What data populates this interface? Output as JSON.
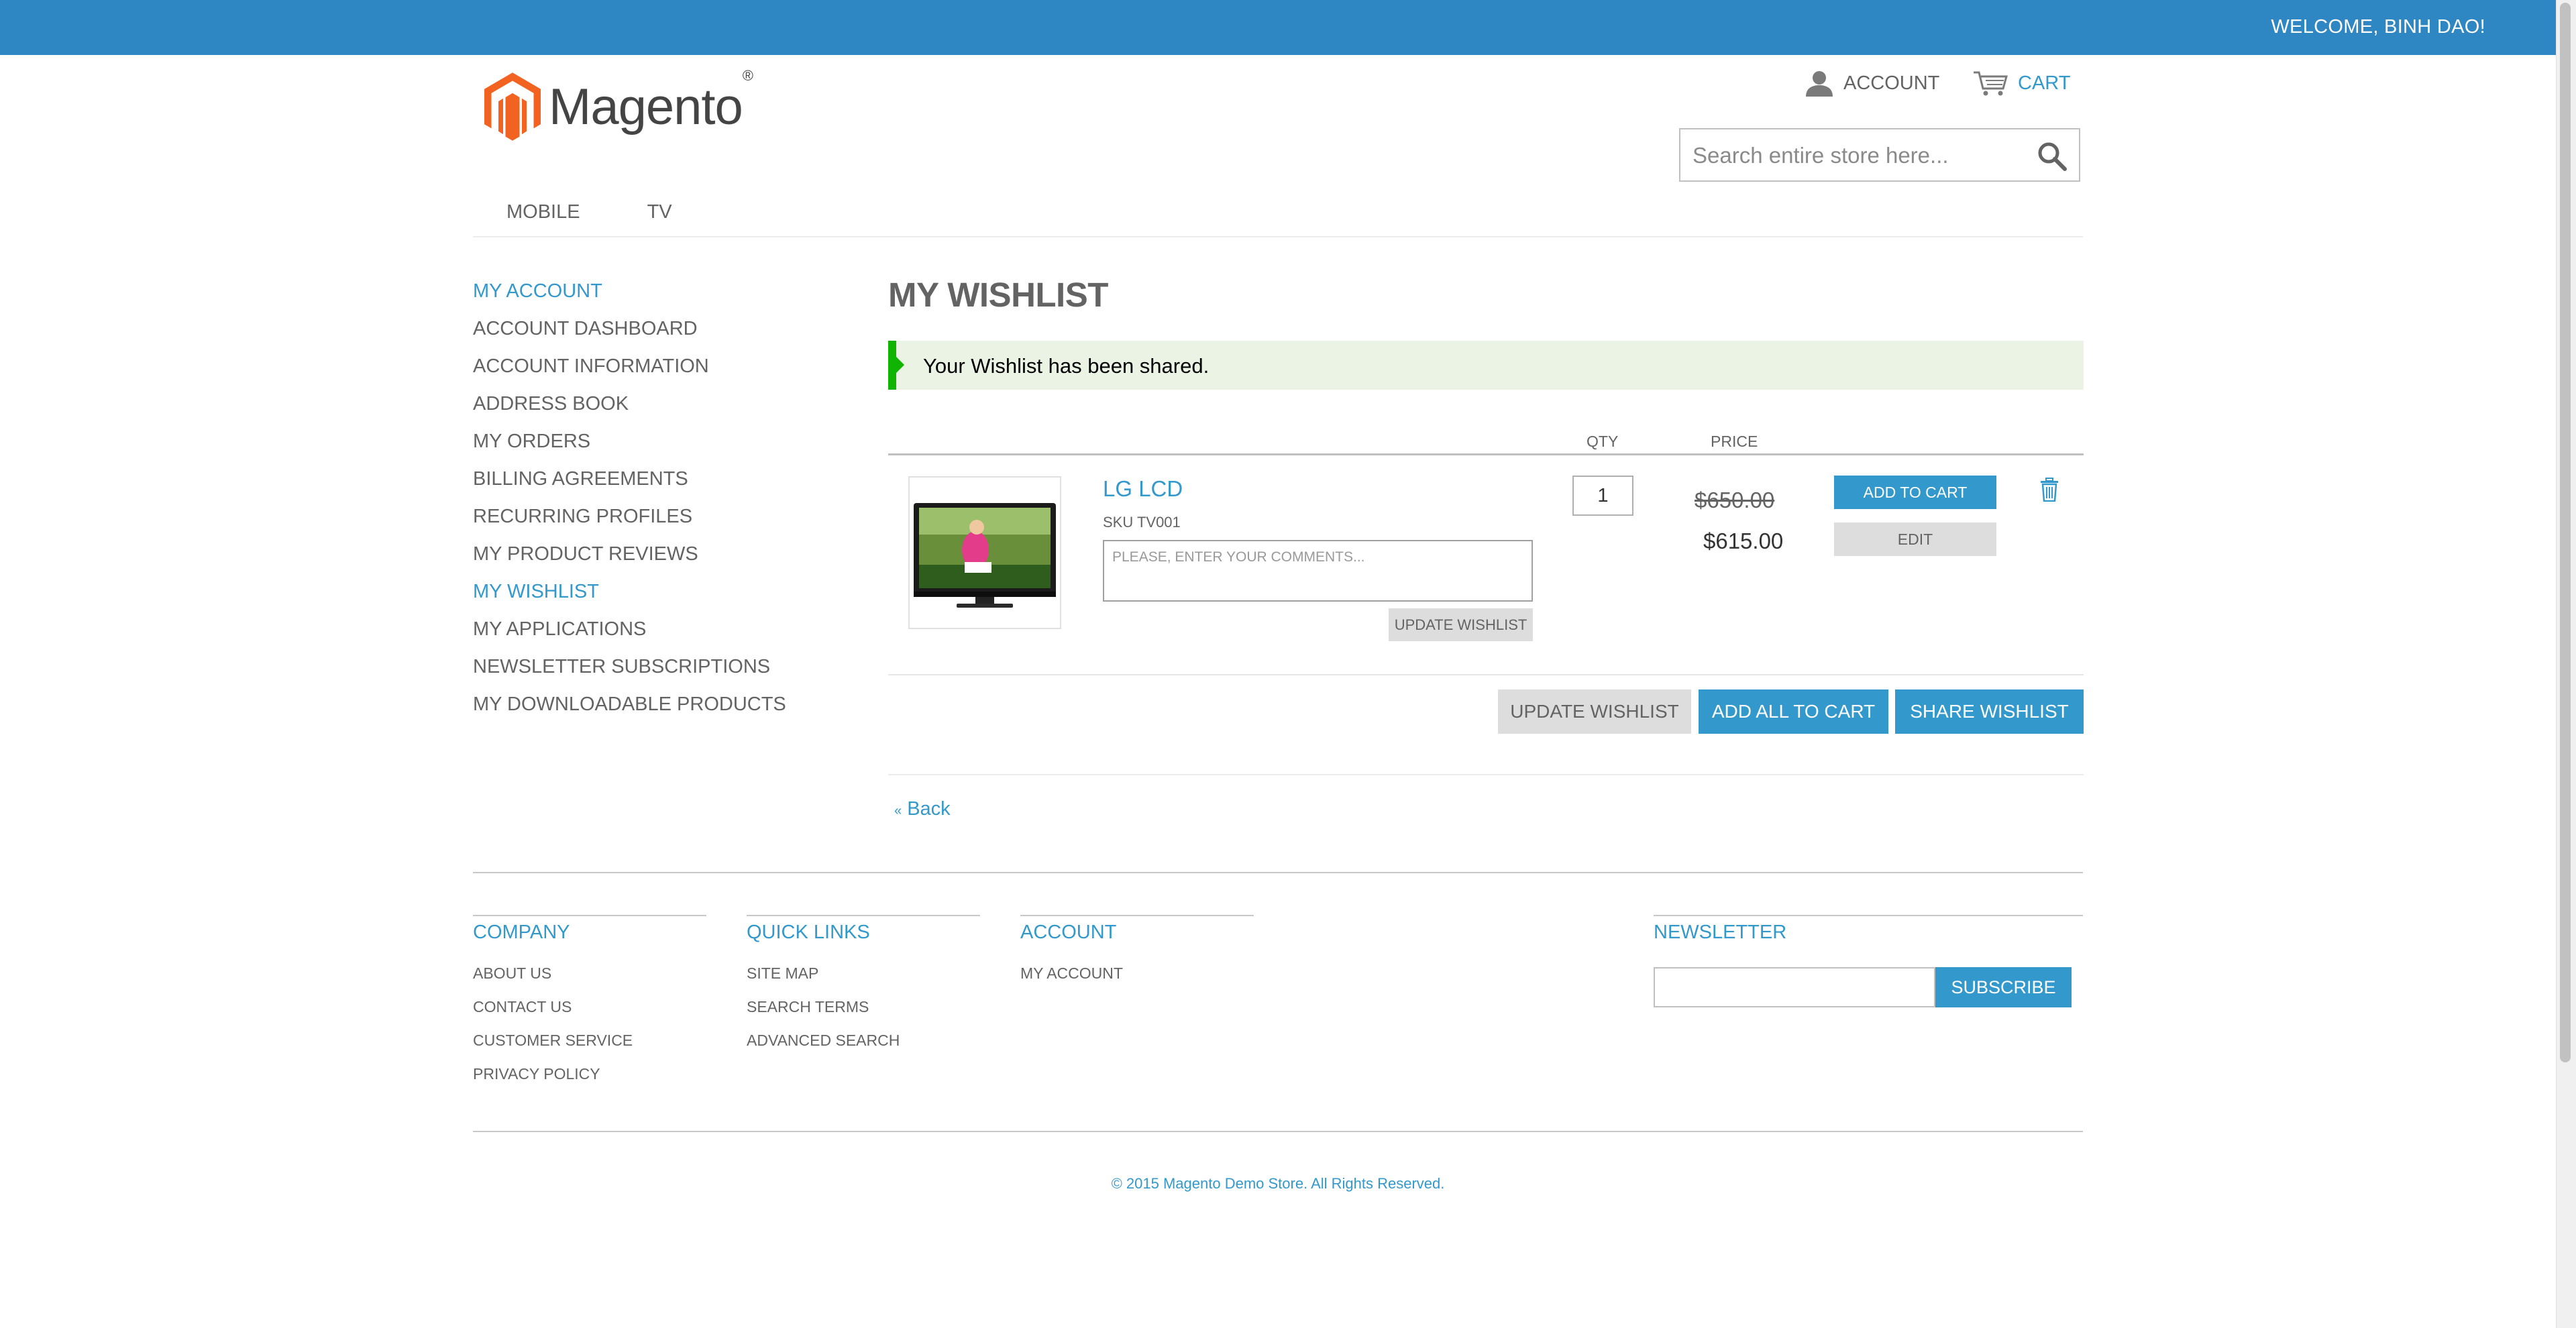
{
  "colors": {
    "top_bar": "#2e86c2",
    "link_blue": "#3399cc",
    "text_gray": "#636363",
    "success_bg": "#eaf3e4",
    "success_accent": "#11b400",
    "logo_orange": "#f26322"
  },
  "topbar": {
    "welcome": "WELCOME, BINH DAO!"
  },
  "header": {
    "logo_text": "Magento",
    "logo_mark": "®",
    "account_label": "ACCOUNT",
    "account_icon": "user-icon",
    "cart_label": "CART",
    "cart_icon": "cart-icon",
    "search_placeholder": "Search entire store here...",
    "search_icon": "search-icon"
  },
  "nav": {
    "items": [
      "MOBILE",
      "TV"
    ]
  },
  "sidebar": {
    "title": "MY ACCOUNT",
    "items": [
      "ACCOUNT DASHBOARD",
      "ACCOUNT INFORMATION",
      "ADDRESS BOOK",
      "MY ORDERS",
      "BILLING AGREEMENTS",
      "RECURRING PROFILES",
      "MY PRODUCT REVIEWS",
      "MY WISHLIST",
      "MY APPLICATIONS",
      "NEWSLETTER SUBSCRIPTIONS",
      "MY DOWNLOADABLE PRODUCTS"
    ],
    "active_item": "MY WISHLIST"
  },
  "main": {
    "title": "MY WISHLIST",
    "success_message": "Your Wishlist has been shared.",
    "table_headers": {
      "qty": "QTY",
      "price": "PRICE"
    },
    "item": {
      "name": "LG LCD",
      "sku": "SKU TV001",
      "comment_placeholder": "PLEASE, ENTER YOUR COMMENTS...",
      "update_label": "UPDATE WISHLIST",
      "qty": "1",
      "old_price": "$650.00",
      "new_price": "$615.00",
      "add_to_cart_label": "ADD TO CART",
      "edit_label": "EDIT",
      "remove_icon": "trash-icon"
    },
    "actions": {
      "update_wishlist": "UPDATE WISHLIST",
      "add_all_to_cart": "ADD ALL TO CART",
      "share_wishlist": "SHARE WISHLIST"
    },
    "back_arrow": "«",
    "back_label": "Back"
  },
  "footer": {
    "company": {
      "title": "COMPANY",
      "links": [
        "ABOUT US",
        "CONTACT US",
        "CUSTOMER SERVICE",
        "PRIVACY POLICY"
      ]
    },
    "quick_links": {
      "title": "QUICK LINKS",
      "links": [
        "SITE MAP",
        "SEARCH TERMS",
        "ADVANCED SEARCH"
      ]
    },
    "account": {
      "title": "ACCOUNT",
      "links": [
        "MY ACCOUNT"
      ]
    },
    "newsletter": {
      "title": "NEWSLETTER",
      "subscribe_label": "SUBSCRIBE"
    },
    "copyright": "© 2015 Magento Demo Store. All Rights Reserved."
  }
}
